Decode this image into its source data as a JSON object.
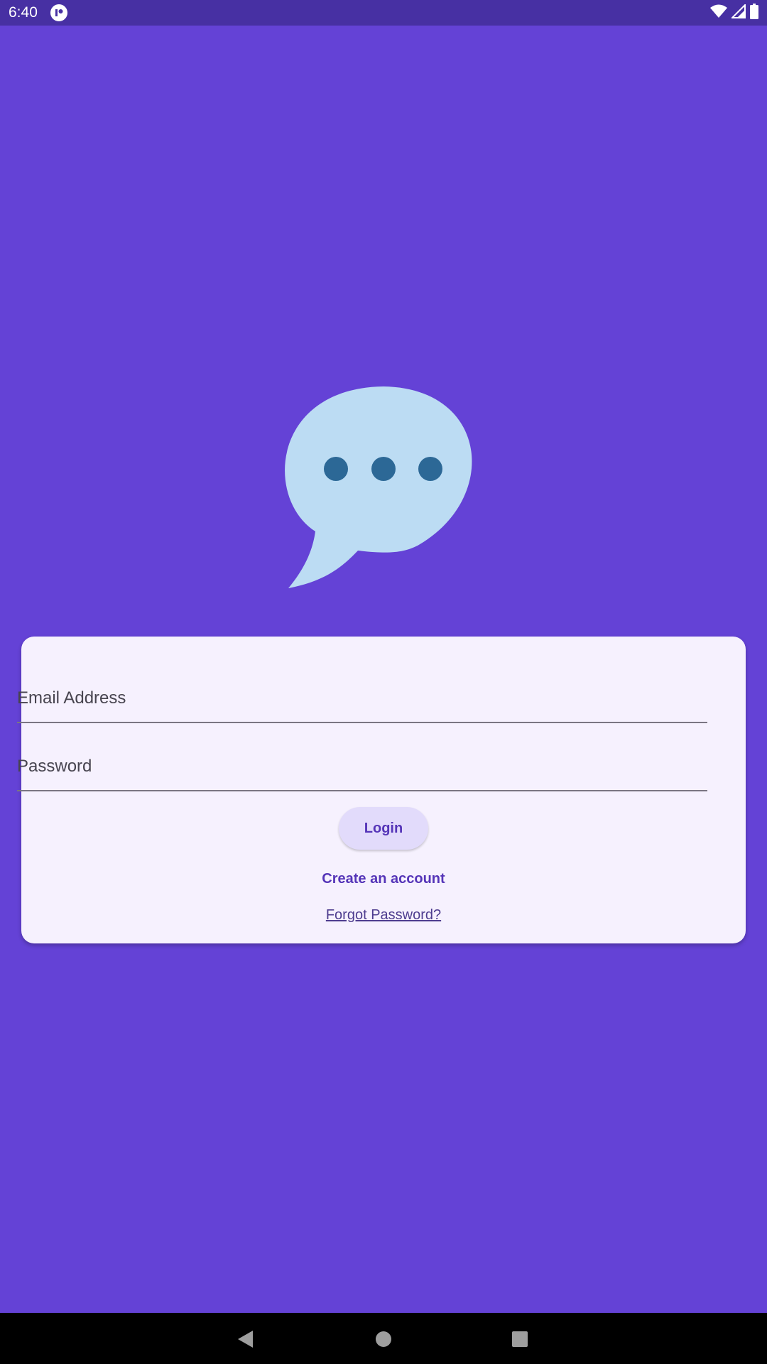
{
  "status_bar": {
    "time": "6:40",
    "icons": [
      "app-notification-icon",
      "wifi-icon",
      "signal-icon",
      "battery-icon"
    ]
  },
  "logo": {
    "icon": "chat-bubble-icon",
    "bubble_color": "#bcdcf3",
    "dot_color": "#2c6896"
  },
  "login_form": {
    "email_placeholder": "Email Address",
    "password_placeholder": "Password",
    "login_label": "Login",
    "create_account_label": "Create an account",
    "forgot_password_label": "Forgot Password?"
  },
  "colors": {
    "background": "#6442d6",
    "status_bar": "#4730a3",
    "card": "#f6f1fe",
    "accent": "#5535b8"
  }
}
